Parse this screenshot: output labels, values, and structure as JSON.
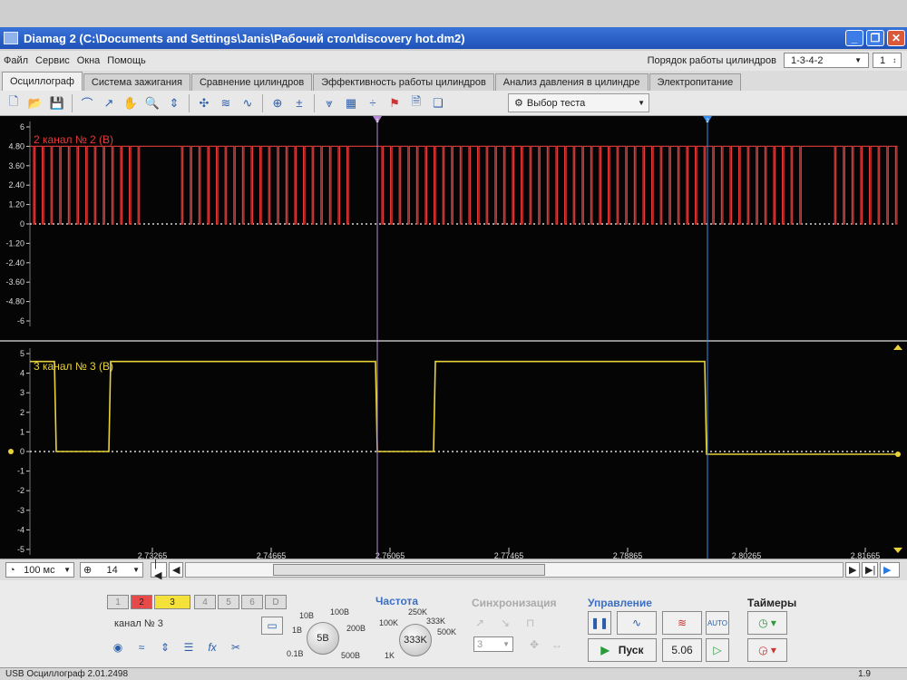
{
  "window": {
    "title": "Diamag 2 (C:\\Documents and Settings\\Janis\\Рабочий стол\\discovery hot.dm2)"
  },
  "menu": {
    "items": [
      "Файл",
      "Сервис",
      "Окна",
      "Помощь"
    ],
    "cyl_order_label": "Порядок работы цилиндров",
    "cyl_order_value": "1-3-4-2",
    "cyl_num_value": "1"
  },
  "tabs": [
    "Осциллограф",
    "Система зажигания",
    "Сравнение цилиндров",
    "Эффективность работы цилиндров",
    "Анализ давления в цилиндре",
    "Электропитание"
  ],
  "toolbar": {
    "test_select": "Выбор теста"
  },
  "channels": [
    {
      "label": "2  канал № 2 (В)",
      "color": "#e23a3a",
      "y_ticks": [
        "6",
        "4.80",
        "3.60",
        "2.40",
        "1.20",
        "0",
        "-1.20",
        "-2.40",
        "-3.60",
        "-4.80",
        "-6"
      ]
    },
    {
      "label": "3  канал № 3 (В)",
      "color": "#e8d23a",
      "y_ticks": [
        "5",
        "4",
        "3",
        "2",
        "1",
        "0",
        "-1",
        "-2",
        "-3",
        "-4",
        "-5"
      ]
    }
  ],
  "x_ticks": [
    "2.73265",
    "2.74665",
    "2.76065",
    "2.77465",
    "2.78865",
    "2.80265",
    "2.81665"
  ],
  "cursors": {
    "c1": "1",
    "c2": "2"
  },
  "bottom": {
    "timebase": "100 мс",
    "zoom": "14"
  },
  "panel": {
    "channel_buttons": [
      "1",
      "2",
      "3",
      "4",
      "5",
      "6",
      "D"
    ],
    "channel_name": "канал № 3",
    "volt_knob": {
      "value": "5В",
      "labels": [
        "10В",
        "100В",
        "1В",
        "200В",
        "0.1В",
        "500В"
      ]
    },
    "freq_title": "Частота",
    "freq_knob": {
      "value": "333K",
      "labels": [
        "250K",
        "100K",
        "333K",
        "500K",
        "1K"
      ]
    },
    "sync_title": "Синхронизация",
    "sync_value": "3",
    "control_title": "Управление",
    "start_label": "Пуск",
    "rate_value": "5.06",
    "auto_label": "AUTO",
    "timers_title": "Таймеры"
  },
  "status": {
    "text": "USB Осциллограф  2.01.2498",
    "right": "1.9"
  }
}
